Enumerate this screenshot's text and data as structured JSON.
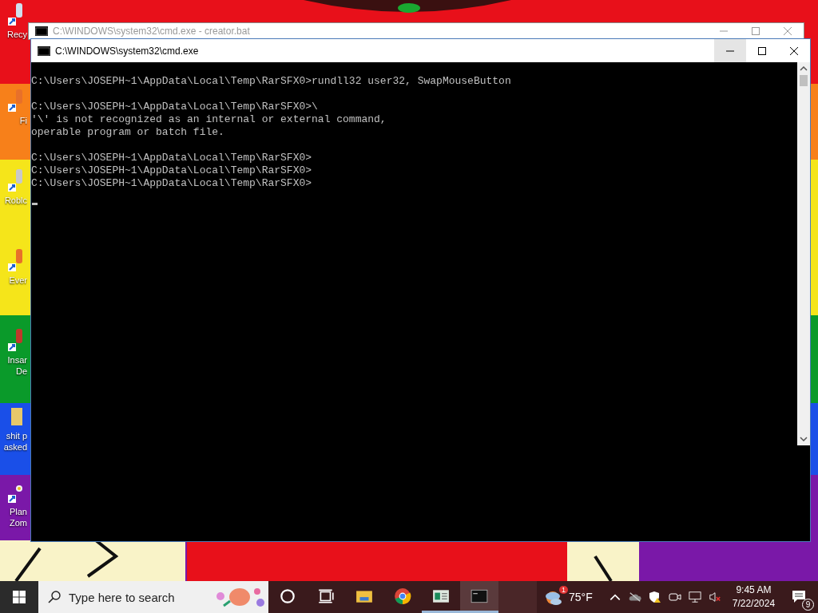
{
  "desktop": {
    "icons": [
      {
        "kind": "recycle",
        "label": "Recy"
      },
      {
        "kind": "orange",
        "label": "Fi"
      },
      {
        "kind": "roblox",
        "label": "Roblc"
      },
      {
        "kind": "orange",
        "label": "Ever"
      },
      {
        "kind": "red",
        "label": "Insar\nDe"
      },
      {
        "kind": "folder",
        "label": "shit p\nasked"
      },
      {
        "kind": "flower",
        "label": "Plan\nZom"
      }
    ]
  },
  "windows": [
    {
      "title": "C:\\WINDOWS\\system32\\cmd.exe - creator.bat",
      "active": false
    },
    {
      "title": "C:\\WINDOWS\\system32\\cmd.exe",
      "active": true,
      "blocks": [
        [
          "C:\\Users\\JOSEPH~1\\AppData\\Local\\Temp\\RarSFX0>rundll32 user32, SwapMouseButton"
        ],
        [
          "C:\\Users\\JOSEPH~1\\AppData\\Local\\Temp\\RarSFX0>\\",
          "'\\' is not recognized as an internal or external command,",
          "operable program or batch file."
        ],
        [
          "C:\\Users\\JOSEPH~1\\AppData\\Local\\Temp\\RarSFX0>",
          "C:\\Users\\JOSEPH~1\\AppData\\Local\\Temp\\RarSFX0>",
          "C:\\Users\\JOSEPH~1\\AppData\\Local\\Temp\\RarSFX0>"
        ]
      ]
    }
  ],
  "taskbar": {
    "search": {
      "placeholder": "Type here to search"
    },
    "apps": [
      {
        "kind": "cortana",
        "running": false,
        "selected": false
      },
      {
        "kind": "taskview",
        "running": false,
        "selected": false
      },
      {
        "kind": "explorer",
        "running": false,
        "selected": false
      },
      {
        "kind": "chrome",
        "running": false,
        "selected": false
      },
      {
        "kind": "sheet",
        "running": true,
        "selected": false
      },
      {
        "kind": "console",
        "running": true,
        "selected": true
      }
    ],
    "weather": {
      "badge": "1",
      "temperature": "75°F"
    },
    "clock": {
      "time": "9:45 AM",
      "date": "7/22/2024"
    },
    "notifications": {
      "count": "9"
    }
  }
}
